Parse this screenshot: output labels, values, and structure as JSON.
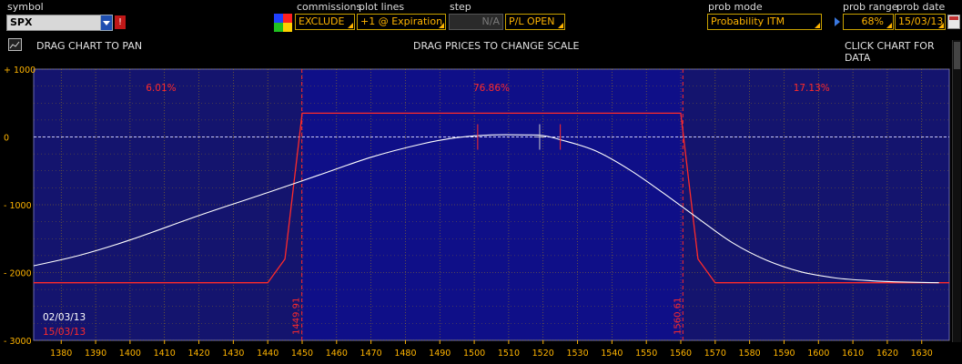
{
  "toolbar": {
    "symbol_label": "symbol",
    "symbol_value": "SPX",
    "commissions_label": "commissions",
    "commissions_value": "EXCLUDE",
    "plot_lines_label": "plot lines",
    "plot_lines_value": "+1 @ Expiration",
    "step_label": "step",
    "step_value": "N/A",
    "pl_value": "P/L OPEN",
    "prob_mode_label": "prob mode",
    "prob_mode_value": "Probability ITM",
    "prob_range_label": "prob range",
    "prob_range_value": "68%",
    "prob_date_label": "prob date",
    "prob_date_value": "15/03/13"
  },
  "hints": {
    "pan": "DRAG CHART TO PAN",
    "scale": "DRAG PRICES TO CHANGE SCALE",
    "data": "CLICK CHART FOR DATA"
  },
  "colors": {
    "plot_bg": "#14146e",
    "zone_inner": "#0f0f88",
    "expiration_line": "#ff2a2a",
    "today_line": "#ffffff",
    "axis_text": "#ffb400"
  },
  "chart_data": {
    "type": "line",
    "x_ticks": [
      1380,
      1390,
      1400,
      1410,
      1420,
      1430,
      1440,
      1450,
      1460,
      1470,
      1480,
      1490,
      1500,
      1510,
      1520,
      1530,
      1540,
      1550,
      1560,
      1570,
      1580,
      1590,
      1600,
      1610,
      1620,
      1630
    ],
    "y_ticks": [
      1000,
      0,
      -1000,
      -2000,
      -3000
    ],
    "y_tick_labels": [
      "+ 1000",
      "0",
      "- 1000",
      "- 2000",
      "- 3000"
    ],
    "xlim": [
      1372,
      1638
    ],
    "ylim": [
      -3000,
      1000
    ],
    "prob_zones": [
      {
        "label": "6.01%",
        "x": 1409
      },
      {
        "label": "76.86%",
        "x": 1505
      },
      {
        "label": "17.13%",
        "x": 1598
      }
    ],
    "breakevens": [
      {
        "label": "1449.91",
        "x": 1449.91
      },
      {
        "label": "1560.61",
        "x": 1560.61
      }
    ],
    "date_legend": [
      {
        "label": "02/03/13",
        "color": "#ffffff"
      },
      {
        "label": "15/03/13",
        "color": "#ff2a2a"
      }
    ],
    "series": [
      {
        "name": "15/03/13",
        "x": [
          1372,
          1440,
          1445,
          1450,
          1560,
          1565,
          1570,
          1638
        ],
        "y": [
          -2150,
          -2150,
          -1800,
          350,
          350,
          -1800,
          -2150,
          -2150
        ]
      },
      {
        "name": "02/03/13",
        "x": [
          1372,
          1385,
          1400,
          1420,
          1440,
          1455,
          1470,
          1485,
          1495,
          1505,
          1515,
          1520,
          1525,
          1535,
          1545,
          1555,
          1565,
          1575,
          1585,
          1595,
          1605,
          1615,
          1625,
          1635
        ],
        "y": [
          -1900,
          -1750,
          -1520,
          -1160,
          -820,
          -560,
          -300,
          -100,
          -10,
          30,
          30,
          20,
          -40,
          -200,
          -480,
          -830,
          -1200,
          -1560,
          -1820,
          -1990,
          -2080,
          -2120,
          -2140,
          -2150
        ]
      }
    ],
    "markers": [
      1501,
      1519,
      1525
    ]
  }
}
